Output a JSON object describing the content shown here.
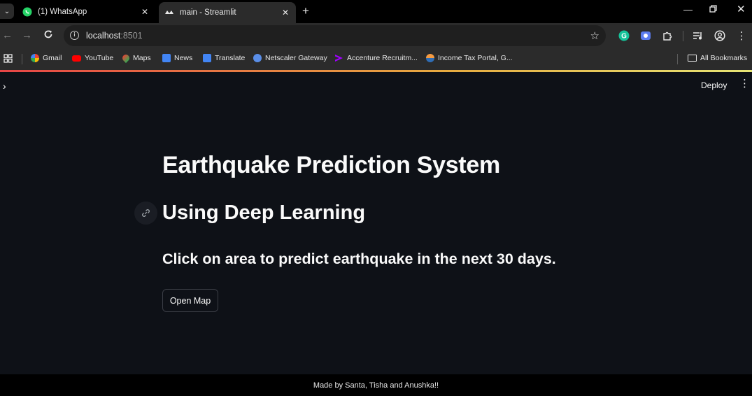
{
  "browser": {
    "tabs": [
      {
        "title": "(1) WhatsApp"
      },
      {
        "title": "main - Streamlit"
      }
    ],
    "url_host": "localhost",
    "url_port": ":8501",
    "bookmarks": [
      {
        "label": "Gmail"
      },
      {
        "label": "YouTube"
      },
      {
        "label": "Maps"
      },
      {
        "label": "News"
      },
      {
        "label": "Translate"
      },
      {
        "label": "Netscaler Gateway"
      },
      {
        "label": "Accenture Recruitm..."
      },
      {
        "label": "Income Tax Portal, G..."
      }
    ],
    "all_bookmarks": "All Bookmarks"
  },
  "app": {
    "deploy_label": "Deploy",
    "title": "Earthquake Prediction System",
    "subtitle": "Using Deep Learning",
    "instruction": "Click on area to predict earthquake in the next 30 days.",
    "open_map_label": "Open Map",
    "footer": "Made by Santa, Tisha and Anushka!!"
  },
  "colors": {
    "app_bg": "#0e1117",
    "text": "#fafafa",
    "chrome_bg": "#2b2b2b",
    "whatsapp_green": "#25d366",
    "streamlit_red": "#ff4b4b"
  }
}
